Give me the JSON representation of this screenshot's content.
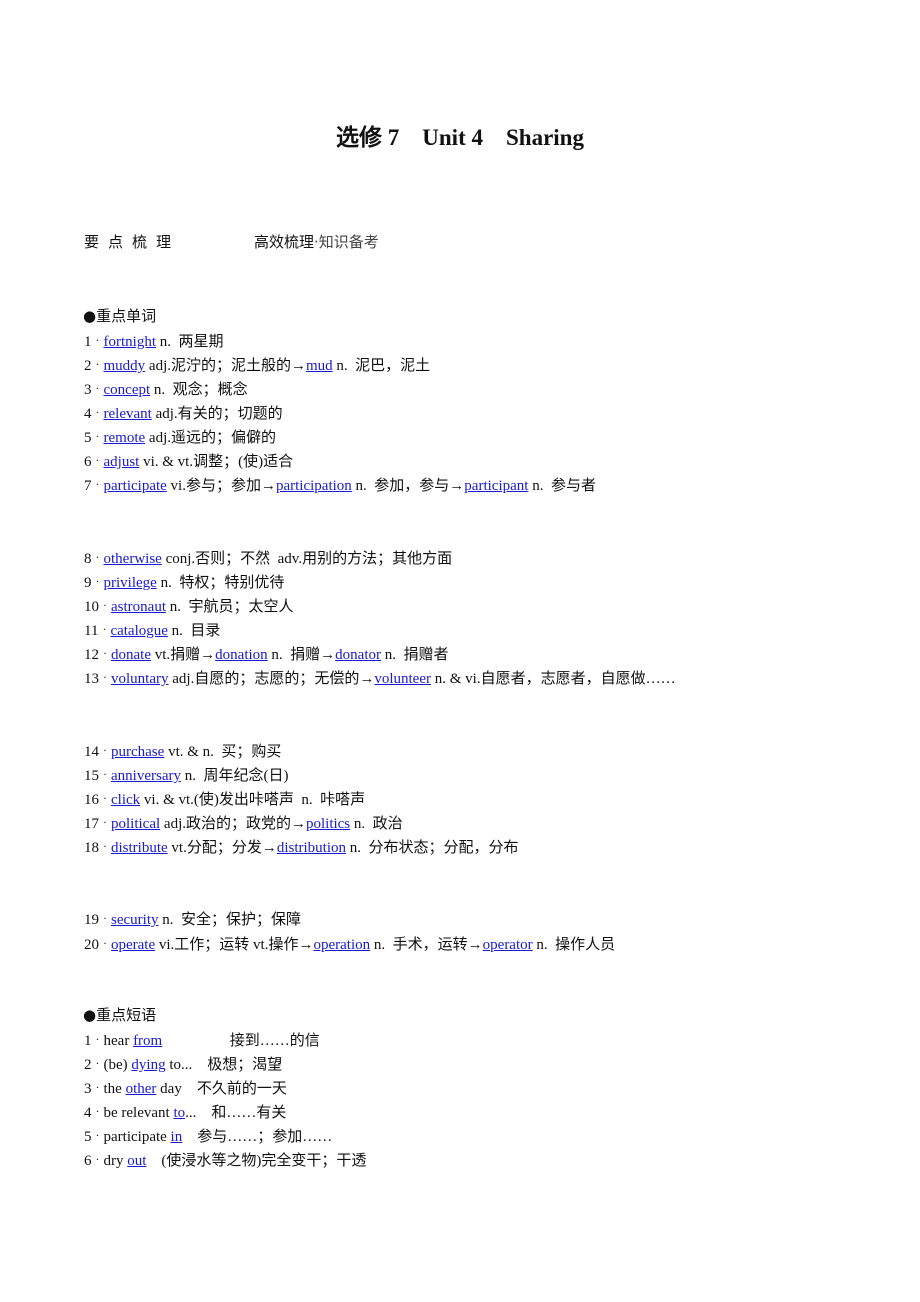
{
  "title": "选修 7    Unit 4    Sharing",
  "header": {
    "label": "要点梳理",
    "sub_bold": "高效梳理",
    "sub_light": "·知识备考"
  },
  "words_section": {
    "title": "●重点单词",
    "items": [
      {
        "num": "1",
        "parts": [
          {
            "t": "fortnight",
            "link": true
          },
          {
            "t": " n.  两星期"
          }
        ]
      },
      {
        "num": "2",
        "parts": [
          {
            "t": "muddy",
            "link": true
          },
          {
            "t": " adj.泥泞的；泥土般的→"
          },
          {
            "t": "mud",
            "link": true
          },
          {
            "t": " n.  泥巴，泥土"
          }
        ]
      },
      {
        "num": "3",
        "parts": [
          {
            "t": "concept",
            "link": true
          },
          {
            "t": " n.  观念；概念"
          }
        ]
      },
      {
        "num": "4",
        "parts": [
          {
            "t": "relevant",
            "link": true
          },
          {
            "t": " adj.有关的；切题的"
          }
        ]
      },
      {
        "num": "5",
        "parts": [
          {
            "t": "remote",
            "link": true
          },
          {
            "t": " adj.遥远的；偏僻的"
          }
        ]
      },
      {
        "num": "6",
        "parts": [
          {
            "t": "adjust",
            "link": true
          },
          {
            "t": " vi. & vt.调整；(使)适合"
          }
        ]
      },
      {
        "num": "7",
        "parts": [
          {
            "t": "participate",
            "link": true
          },
          {
            "t": " vi.参与；参加→"
          },
          {
            "t": "participation",
            "link": true
          },
          {
            "t": " n.  参加，参与→"
          },
          {
            "t": "participant",
            "link": true
          },
          {
            "t": " n.  参与者"
          }
        ]
      },
      {
        "num": "8",
        "parts": [
          {
            "t": "otherwise",
            "link": true
          },
          {
            "t": " conj.否则；不然  adv.用别的方法；其他方面"
          }
        ]
      },
      {
        "num": "9",
        "parts": [
          {
            "t": "privilege",
            "link": true
          },
          {
            "t": " n.  特权；特别优待"
          }
        ]
      },
      {
        "num": "10",
        "parts": [
          {
            "t": "astronaut",
            "link": true
          },
          {
            "t": " n.  宇航员；太空人"
          }
        ]
      },
      {
        "num": "11",
        "parts": [
          {
            "t": "catalogue",
            "link": true
          },
          {
            "t": " n.  目录"
          }
        ]
      },
      {
        "num": "12",
        "parts": [
          {
            "t": "donate",
            "link": true
          },
          {
            "t": " vt.捐赠→"
          },
          {
            "t": "donation",
            "link": true
          },
          {
            "t": " n.  捐赠→"
          },
          {
            "t": "donator",
            "link": true
          },
          {
            "t": " n.  捐赠者"
          }
        ]
      },
      {
        "num": "13",
        "parts": [
          {
            "t": "voluntary",
            "link": true
          },
          {
            "t": " adj.自愿的；志愿的；无偿的→"
          },
          {
            "t": "volunteer",
            "link": true
          },
          {
            "t": " n. & vi.自愿者，志愿者，自愿做……"
          }
        ]
      },
      {
        "num": "14",
        "parts": [
          {
            "t": "purchase",
            "link": true
          },
          {
            "t": " vt. & n.  买；购买"
          }
        ]
      },
      {
        "num": "15",
        "parts": [
          {
            "t": "anniversary",
            "link": true
          },
          {
            "t": " n.  周年纪念(日)"
          }
        ]
      },
      {
        "num": "16",
        "parts": [
          {
            "t": "click",
            "link": true
          },
          {
            "t": " vi. & vt.(使)发出咔嗒声  n.  咔嗒声"
          }
        ]
      },
      {
        "num": "17",
        "parts": [
          {
            "t": "political",
            "link": true
          },
          {
            "t": " adj.政治的；政党的→"
          },
          {
            "t": "politics",
            "link": true
          },
          {
            "t": " n.  政治"
          }
        ]
      },
      {
        "num": "18",
        "parts": [
          {
            "t": "distribute",
            "link": true
          },
          {
            "t": " vt.分配；分发→"
          },
          {
            "t": "distribution",
            "link": true
          },
          {
            "t": " n.  分布状态；分配，分布"
          }
        ]
      },
      {
        "num": "19",
        "parts": [
          {
            "t": "security",
            "link": true
          },
          {
            "t": " n.  安全；保护；保障"
          }
        ]
      },
      {
        "num": "20",
        "parts": [
          {
            "t": "operate",
            "link": true
          },
          {
            "t": " vi.工作；运转 vt.操作→"
          },
          {
            "t": "operation",
            "link": true
          },
          {
            "t": " n.  手术，运转→"
          },
          {
            "t": "operator",
            "link": true
          },
          {
            "t": " n.  操作人员"
          }
        ]
      }
    ]
  },
  "phrases_section": {
    "title": "●重点短语",
    "items": [
      {
        "num": "1",
        "parts": [
          {
            "t": "hear "
          },
          {
            "t": "from",
            "link": true
          },
          {
            "t": "                  接到……的信"
          }
        ]
      },
      {
        "num": "2",
        "parts": [
          {
            "t": "(be) "
          },
          {
            "t": "dying",
            "link": true
          },
          {
            "t": " to...    极想；渴望"
          }
        ]
      },
      {
        "num": "3",
        "parts": [
          {
            "t": "the "
          },
          {
            "t": "other",
            "link": true
          },
          {
            "t": " day    不久前的一天"
          }
        ]
      },
      {
        "num": "4",
        "parts": [
          {
            "t": "be relevant "
          },
          {
            "t": "to",
            "link": true
          },
          {
            "t": "...    和……有关"
          }
        ]
      },
      {
        "num": "5",
        "parts": [
          {
            "t": "participate "
          },
          {
            "t": "in",
            "link": true
          },
          {
            "t": "    参与……；参加……"
          }
        ]
      },
      {
        "num": "6",
        "parts": [
          {
            "t": "dry "
          },
          {
            "t": "out",
            "link": true
          },
          {
            "t": "    (使浸水等之物)完全变干；干透"
          }
        ]
      }
    ]
  }
}
